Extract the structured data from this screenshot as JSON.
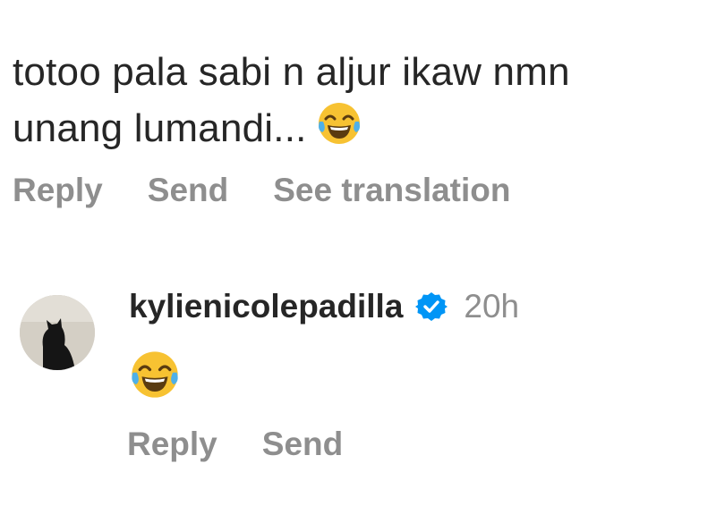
{
  "comment": {
    "text_line1": "totoo pala sabi n aljur ikaw nmn",
    "text_line2": "unang lumandi...",
    "emoji": "face-with-tears-of-joy-icon",
    "actions": {
      "reply": "Reply",
      "send": "Send",
      "translate": "See translation"
    }
  },
  "reply": {
    "username": "kylienicolepadilla",
    "verified_icon": "verified-badge-icon",
    "verified_color": "#0095f6",
    "timestamp": "20h",
    "emoji": "face-with-tears-of-joy-icon",
    "actions": {
      "reply": "Reply",
      "send": "Send"
    }
  },
  "colors": {
    "text": "#262626",
    "muted": "#8e8e8e"
  }
}
